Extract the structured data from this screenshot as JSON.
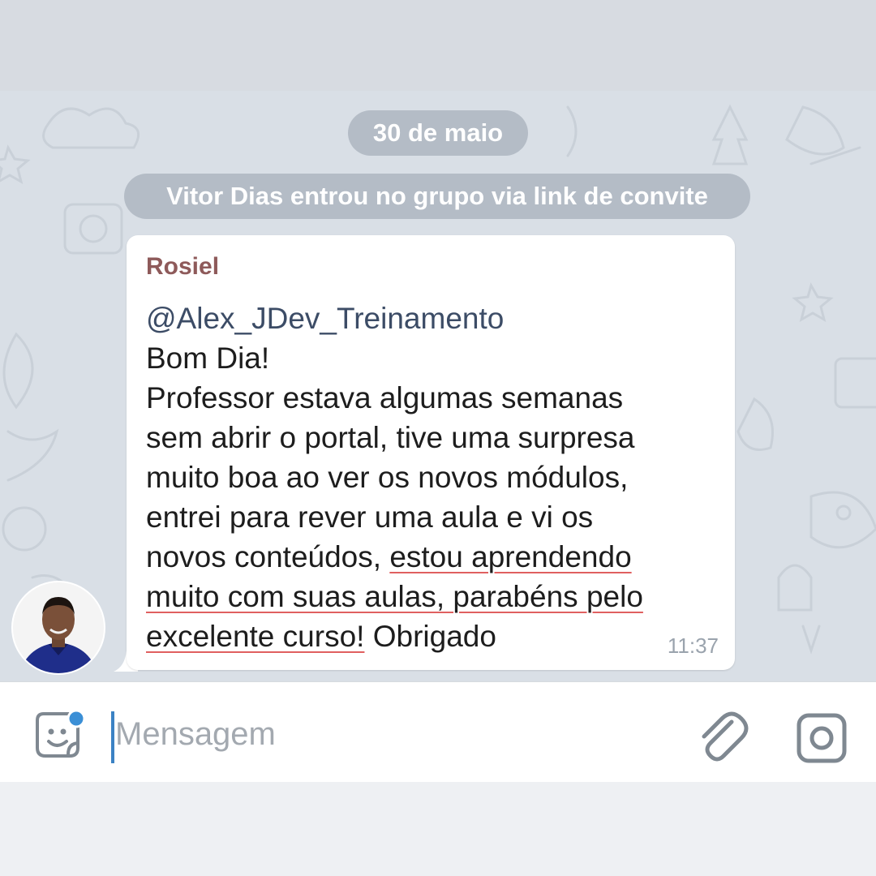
{
  "chat": {
    "date_label": "30 de maio",
    "service_message": "Vitor Dias entrou no grupo via link de convite",
    "message": {
      "sender": "Rosiel",
      "mention": "@Alex_JDev_Treinamento",
      "lines": [
        "Bom Dia!",
        "Professor estava algumas semanas",
        "sem abrir o portal, tive uma surpresa",
        "muito boa ao ver os novos módulos,",
        "entrei para rever uma aula e vi os"
      ],
      "line6_plain": "novos conteúdos, ",
      "line6_underlined": "estou aprendendo",
      "line7_underlined": "muito com suas aulas, parabéns pelo",
      "line8_underlined": "excelente curso!",
      "line8_plain": " Obrigado",
      "time": "11:37"
    }
  },
  "input_bar": {
    "placeholder": "Mensagem"
  },
  "icons": {
    "sticker": "sticker-smile-icon",
    "attach": "paperclip-icon",
    "camera": "camera-icon",
    "notification_dot_color": "#3b8fd6"
  },
  "colors": {
    "chat_background": "#d9dfe6",
    "pill_background": "#b4bcc6",
    "sender_name": "#8e5a5a",
    "caret": "#3b82c4"
  }
}
